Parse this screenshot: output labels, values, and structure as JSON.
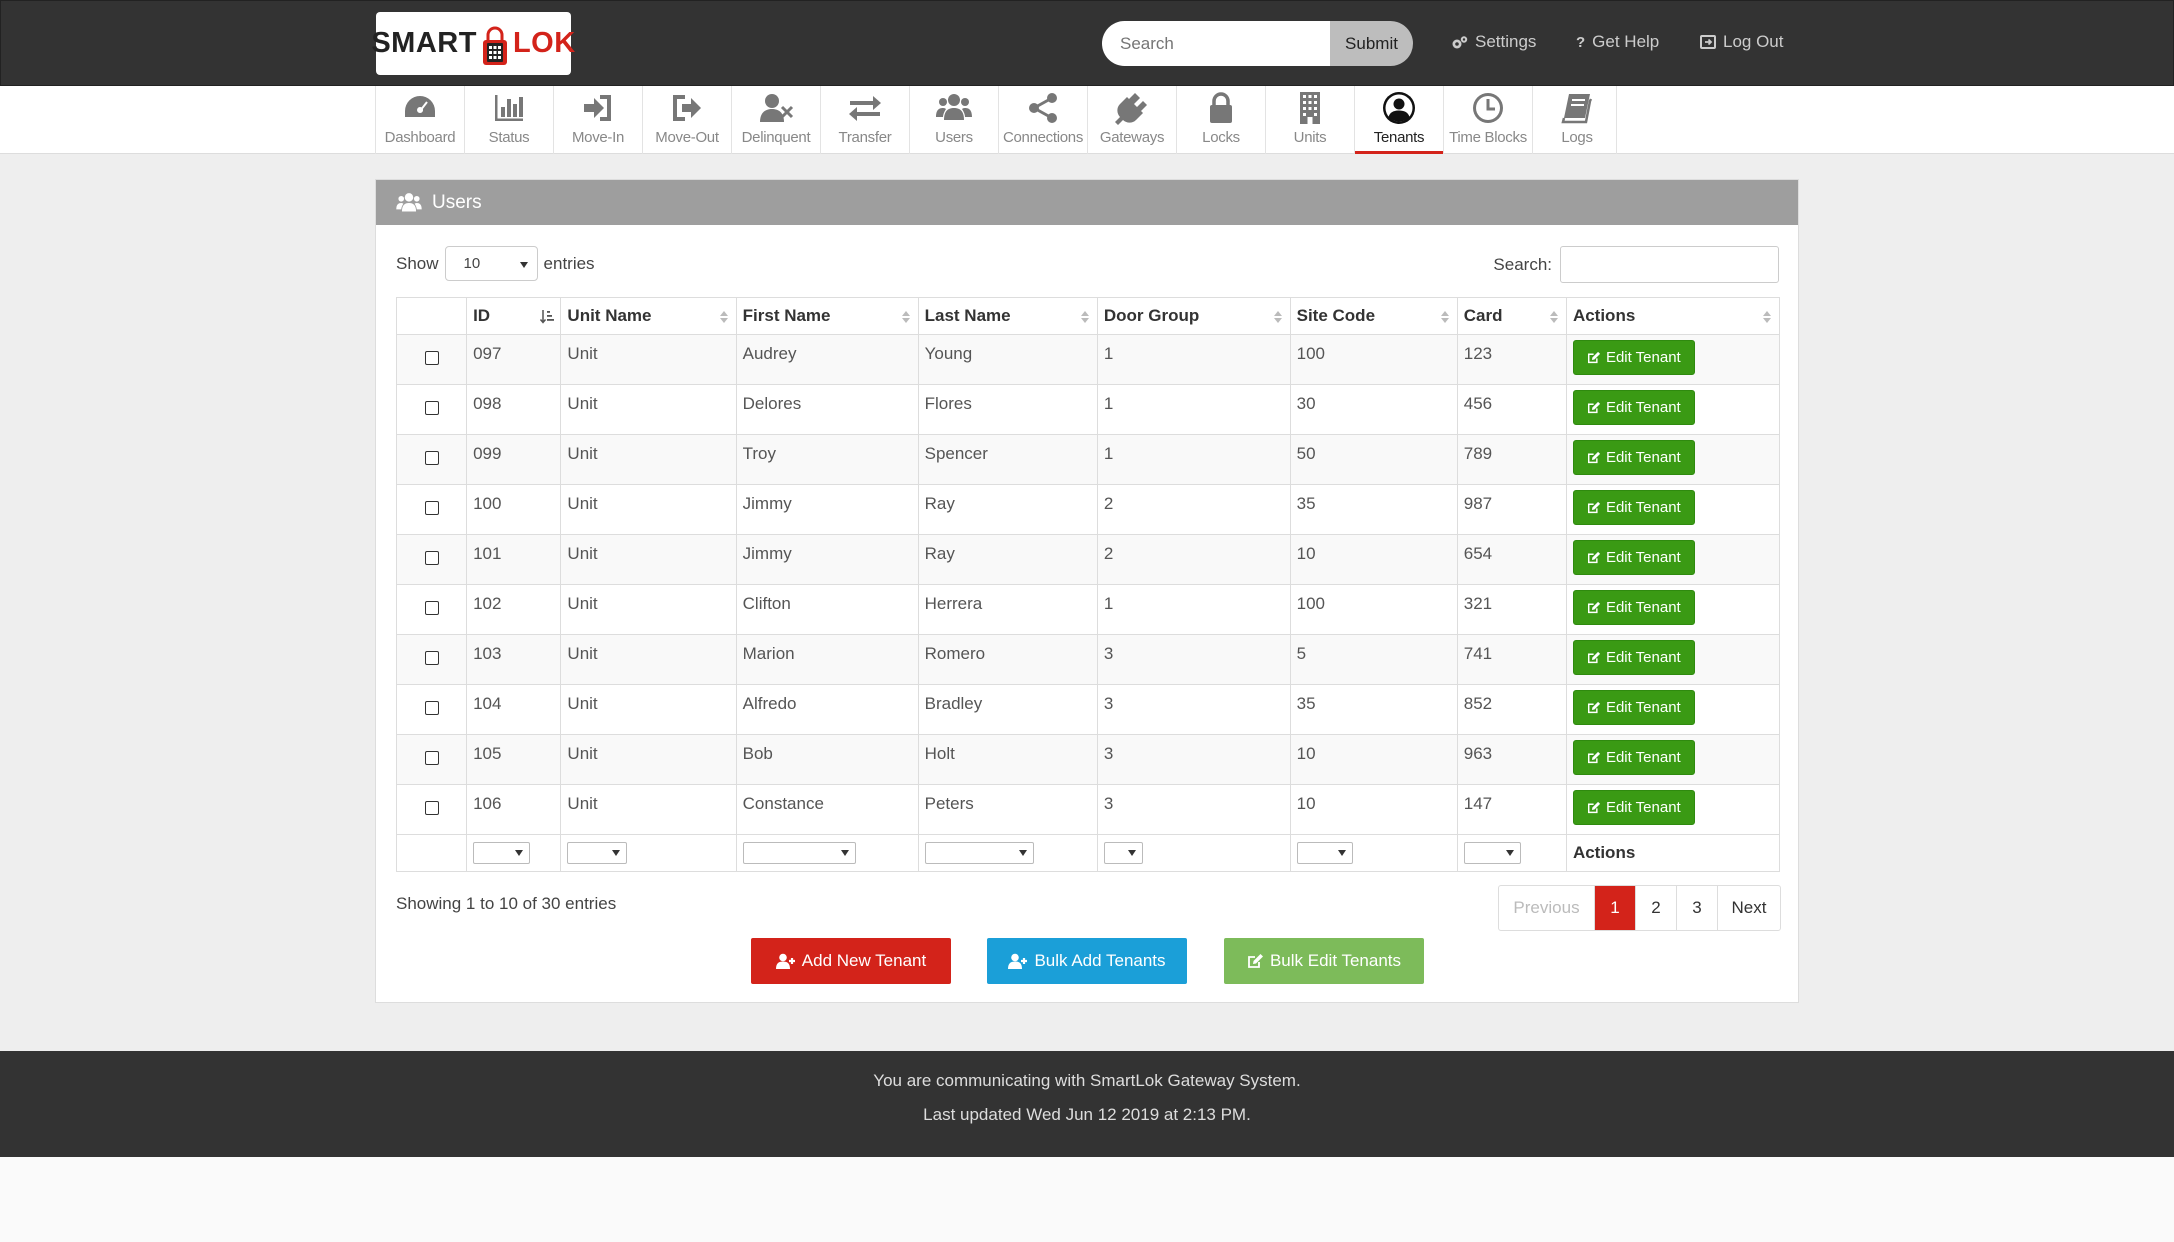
{
  "brand": {
    "part1": "SMART",
    "part2": "LOK",
    "accent": "#d3231a"
  },
  "search": {
    "placeholder": "Search",
    "submit": "Submit"
  },
  "toplinks": {
    "settings": "Settings",
    "help": "Get Help",
    "logout": "Log Out"
  },
  "nav": {
    "active": "Tenants",
    "items": [
      "Dashboard",
      "Status",
      "Move-In",
      "Move-Out",
      "Delinquent",
      "Transfer",
      "Users",
      "Connections",
      "Gateways",
      "Locks",
      "Units",
      "Tenants",
      "Time Blocks",
      "Logs"
    ]
  },
  "panel": {
    "title": "Users"
  },
  "table": {
    "show_label": "Show",
    "entries_value": "10",
    "entries_label": "entries",
    "search_label": "Search:",
    "columns": [
      "ID",
      "Unit Name",
      "First Name",
      "Last Name",
      "Door Group",
      "Site Code",
      "Card",
      "Actions"
    ],
    "action_label": "Edit Tenant",
    "footer_actions": "Actions",
    "rows": [
      [
        "097",
        "Unit",
        "Audrey",
        "Young",
        "1",
        "100",
        "123"
      ],
      [
        "098",
        "Unit",
        "Delores",
        "Flores",
        "1",
        "30",
        "456"
      ],
      [
        "099",
        "Unit",
        "Troy",
        "Spencer",
        "1",
        "50",
        "789"
      ],
      [
        "100",
        "Unit",
        "Jimmy",
        "Ray",
        "2",
        "35",
        "987"
      ],
      [
        "101",
        "Unit",
        "Jimmy",
        "Ray",
        "2",
        "10",
        "654"
      ],
      [
        "102",
        "Unit",
        "Clifton",
        "Herrera",
        "1",
        "100",
        "321"
      ],
      [
        "103",
        "Unit",
        "Marion",
        "Romero",
        "3",
        "5",
        "741"
      ],
      [
        "104",
        "Unit",
        "Alfredo",
        "Bradley",
        "3",
        "35",
        "852"
      ],
      [
        "105",
        "Unit",
        "Bob",
        "Holt",
        "3",
        "10",
        "963"
      ],
      [
        "106",
        "Unit",
        "Constance",
        "Peters",
        "3",
        "10",
        "147"
      ]
    ],
    "info": "Showing 1 to 10 of 30 entries"
  },
  "pagination": {
    "prev": "Previous",
    "pages": [
      "1",
      "2",
      "3"
    ],
    "current": "1",
    "next": "Next"
  },
  "buttons": {
    "add": "Add New Tenant",
    "bulk_add": "Bulk Add Tenants",
    "bulk_edit": "Bulk Edit Tenants"
  },
  "colors": {
    "add": "#d3231a",
    "bulk_add": "#1b9fd8",
    "bulk_edit": "#7dbb5a",
    "edit": "#3a9a14"
  },
  "footer": {
    "line1": "You are communicating with SmartLok Gateway System.",
    "line2": "Last updated Wed Jun 12 2019 at 2:13 PM."
  }
}
